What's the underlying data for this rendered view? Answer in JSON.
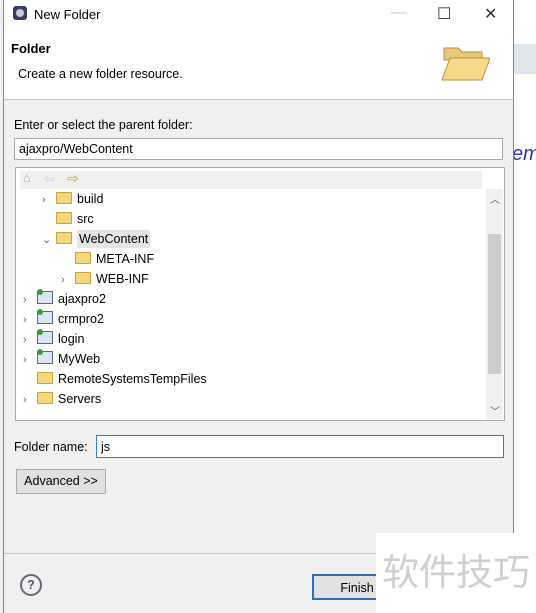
{
  "window": {
    "title": "New Folder",
    "minimize": "—",
    "maximize": "☐",
    "close": "✕"
  },
  "header": {
    "title": "Folder",
    "description": "Create a new folder resource."
  },
  "parent": {
    "label": "Enter or select the parent folder:",
    "value": "ajaxpro/WebContent"
  },
  "tree": {
    "items": [
      {
        "label": "build",
        "type": "folder",
        "expandable": true,
        "expanded": false
      },
      {
        "label": "src",
        "type": "folder",
        "expandable": false
      },
      {
        "label": "WebContent",
        "type": "folder",
        "expandable": true,
        "expanded": true,
        "selected": true
      },
      {
        "label": "META-INF",
        "type": "folder",
        "expandable": false
      },
      {
        "label": "WEB-INF",
        "type": "folder",
        "expandable": true,
        "expanded": false
      },
      {
        "label": "ajaxpro2",
        "type": "project",
        "expandable": true
      },
      {
        "label": "crmpro2",
        "type": "project",
        "expandable": true
      },
      {
        "label": "login",
        "type": "project",
        "expandable": true
      },
      {
        "label": "MyWeb",
        "type": "project",
        "expandable": true
      },
      {
        "label": "RemoteSystemsTempFiles",
        "type": "folder",
        "expandable": false
      },
      {
        "label": "Servers",
        "type": "folder",
        "expandable": true
      }
    ]
  },
  "folder_name": {
    "label": "Folder name:",
    "value": "js"
  },
  "advanced_label": "Advanced >>",
  "finish_label": "Finish",
  "help_label": "?",
  "watermark": "软件技巧",
  "background_text": "em"
}
